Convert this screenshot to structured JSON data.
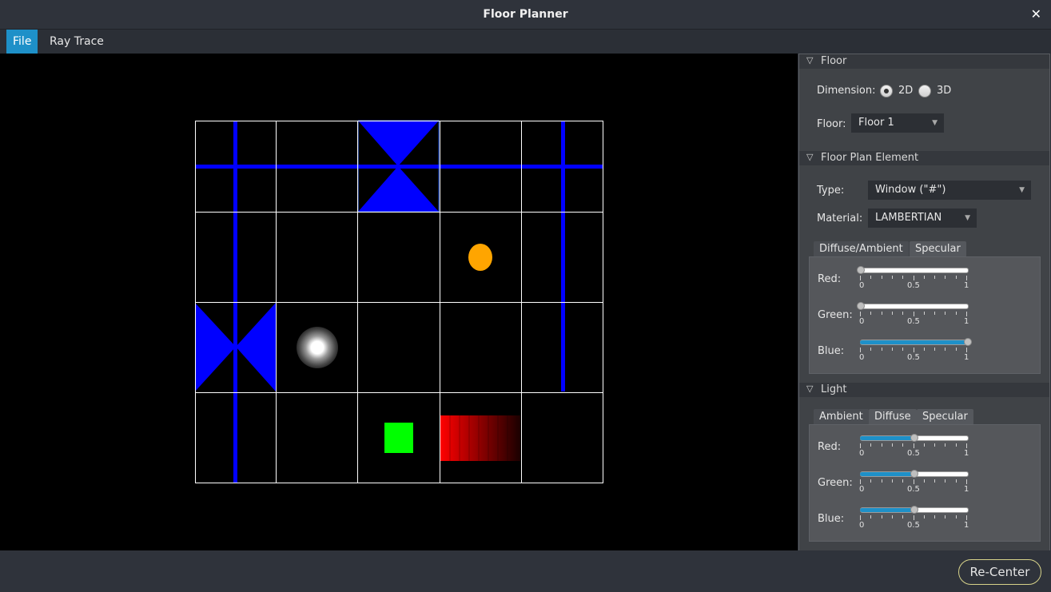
{
  "window": {
    "title": "Floor Planner",
    "close_glyph": "✕"
  },
  "menu": {
    "items": [
      {
        "label": "File",
        "active": true
      },
      {
        "label": "Ray Trace",
        "active": false
      }
    ]
  },
  "floor_section": {
    "title": "Floor",
    "dimension_label": "Dimension:",
    "dimension_options": [
      "2D",
      "3D"
    ],
    "dimension_selected": "2D",
    "floor_label": "Floor:",
    "floor_value": "Floor 1"
  },
  "element_section": {
    "title": "Floor Plan Element",
    "type_label": "Type:",
    "type_value": "Window (\"#\")",
    "material_label": "Material:",
    "material_value": "LAMBERTIAN",
    "tabs": [
      "Diffuse/Ambient",
      "Specular"
    ],
    "sliders": [
      {
        "label": "Red:",
        "value": 0
      },
      {
        "label": "Green:",
        "value": 0
      },
      {
        "label": "Blue:",
        "value": 1
      }
    ]
  },
  "light_section": {
    "title": "Light",
    "tabs": [
      "Ambient",
      "Diffuse",
      "Specular"
    ],
    "sliders": [
      {
        "label": "Red:",
        "value": 0.5
      },
      {
        "label": "Green:",
        "value": 0.5
      },
      {
        "label": "Blue:",
        "value": 0.5
      }
    ]
  },
  "slider_tick_labels": [
    "0",
    "0.5",
    "1"
  ],
  "bottom": {
    "recenter_label": "Re-Center"
  },
  "colors": {
    "accent": "#1e90c8",
    "wall_blue": "#0000ff",
    "light_orange": "#ffa500",
    "object_green": "#00ff00",
    "object_red": "#ff0000",
    "grid_line": "#ffffff"
  }
}
